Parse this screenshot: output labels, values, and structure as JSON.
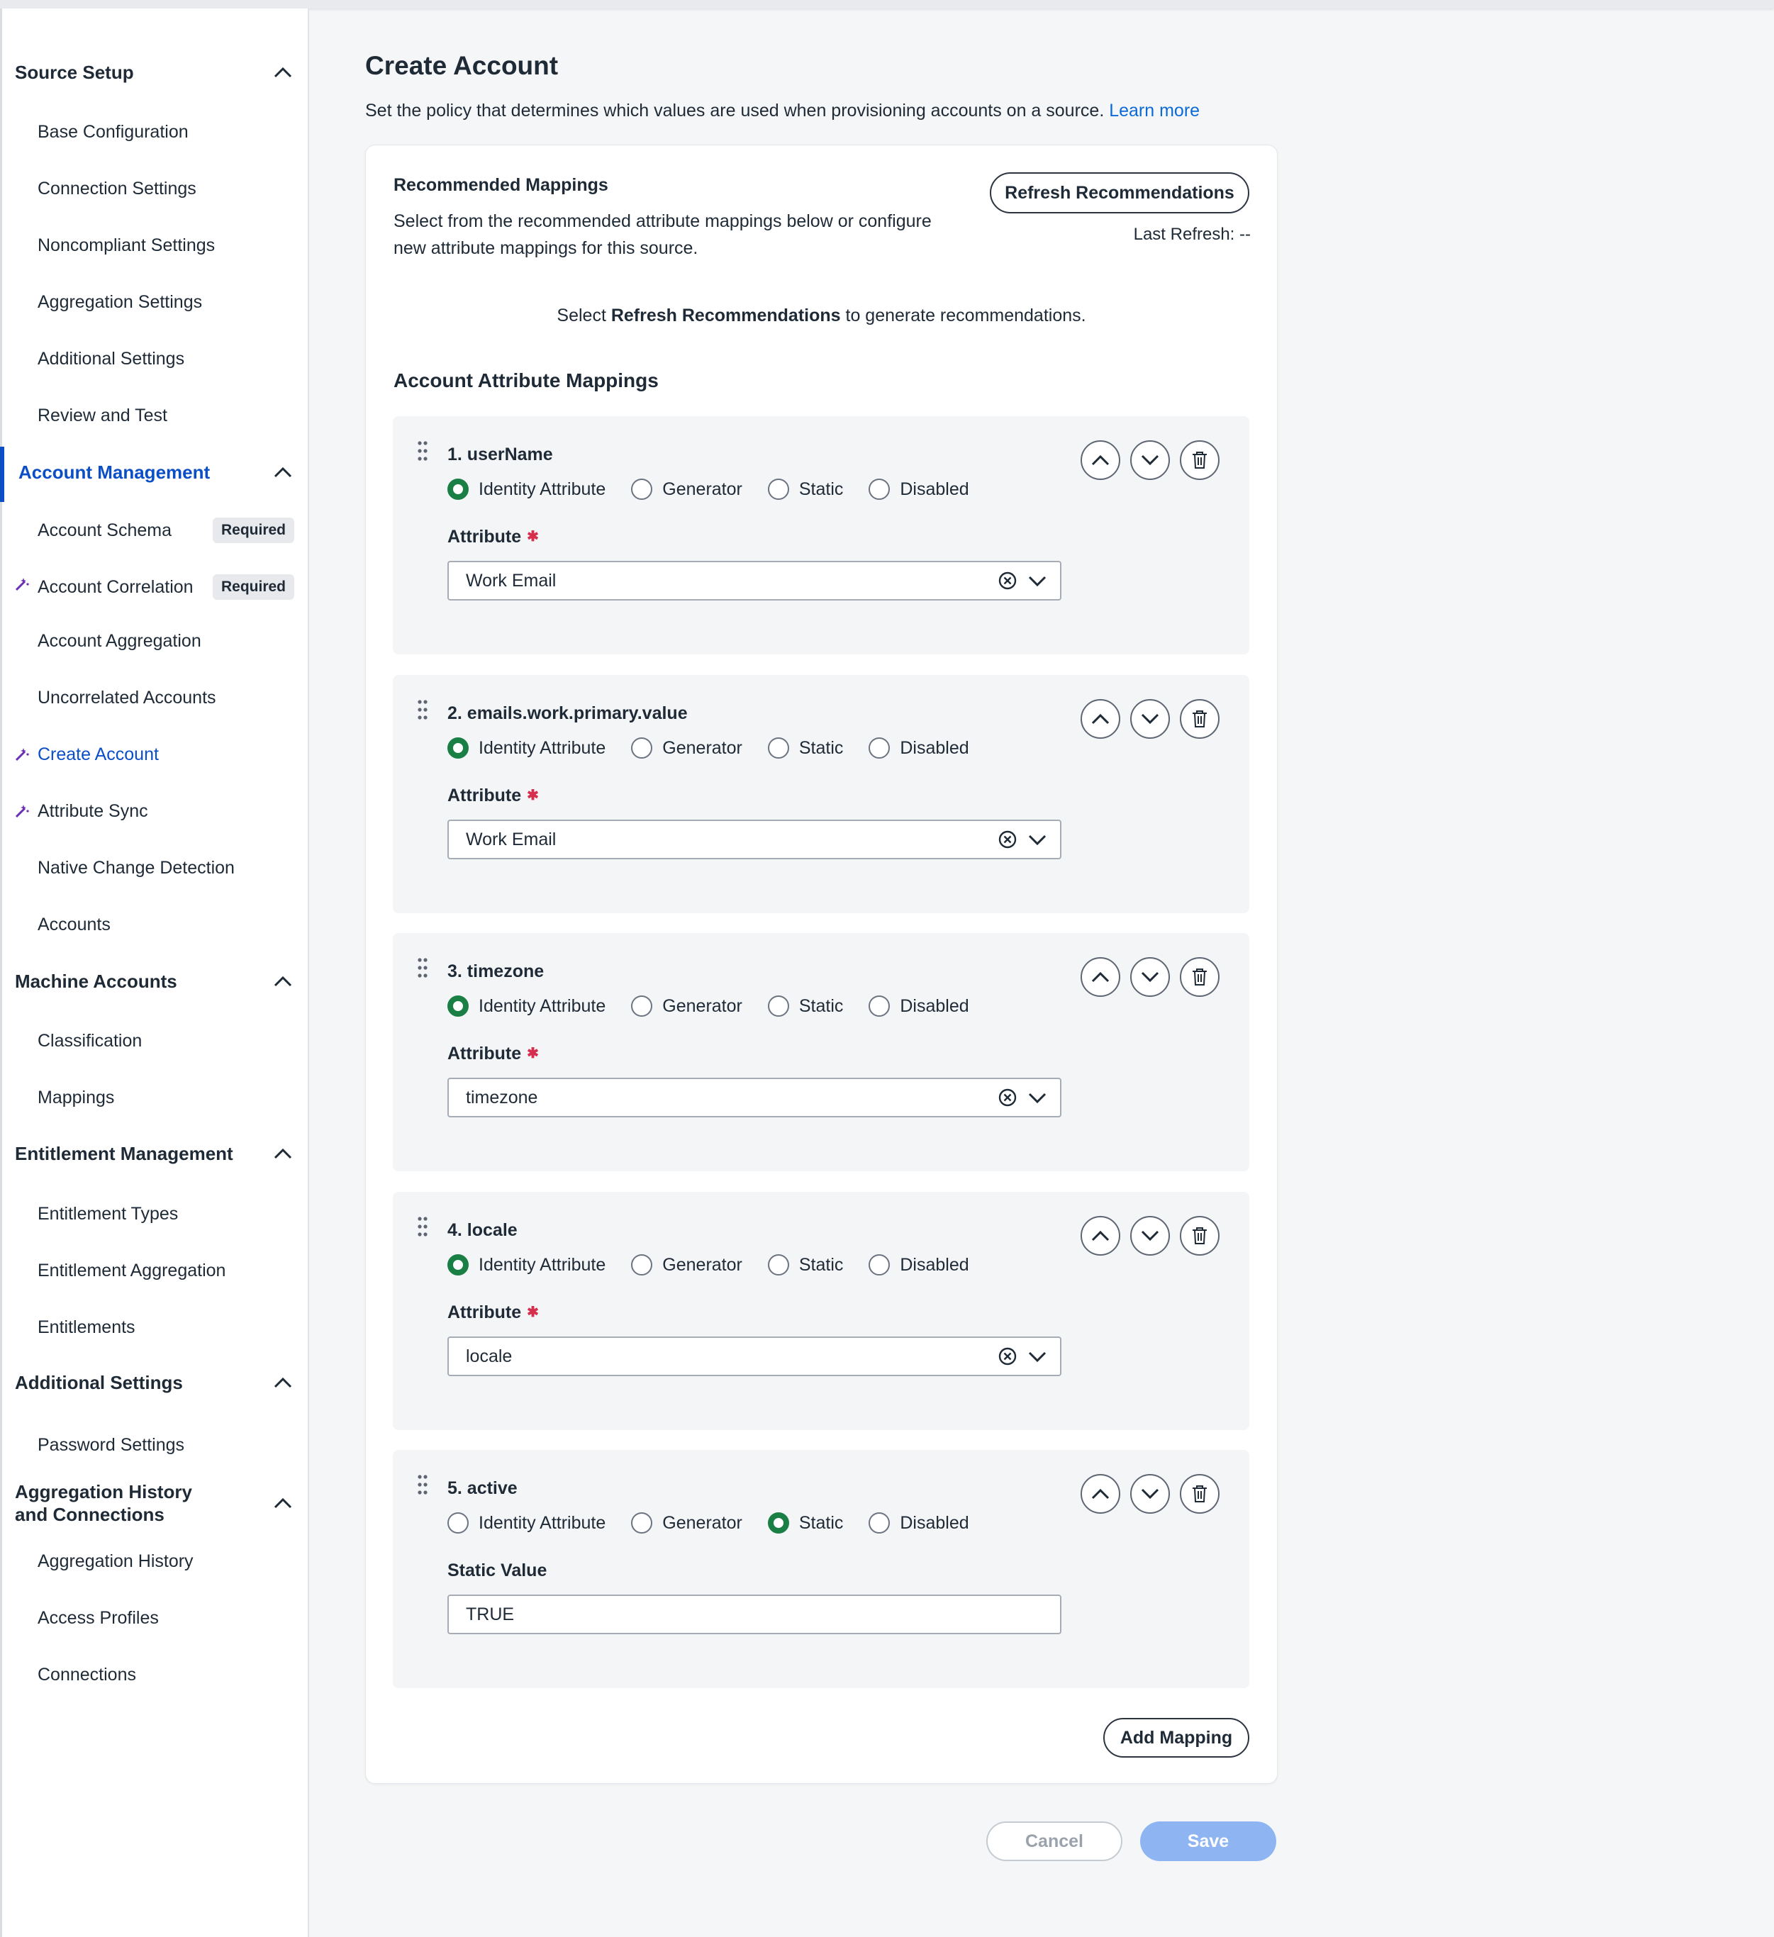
{
  "sidebar": {
    "sections": [
      {
        "label": "Source Setup",
        "items": [
          "Base Configuration",
          "Connection Settings",
          "Noncompliant Settings",
          "Aggregation Settings",
          "Additional Settings",
          "Review and Test"
        ]
      },
      {
        "label": "Account Management",
        "items": [
          "Account Schema",
          "Account Correlation",
          "Account Aggregation",
          "Uncorrelated Accounts",
          "Create Account",
          "Attribute Sync",
          "Native Change Detection",
          "Accounts"
        ]
      },
      {
        "label": "Machine Accounts",
        "items": [
          "Classification",
          "Mappings"
        ]
      },
      {
        "label": "Entitlement Management",
        "items": [
          "Entitlement Types",
          "Entitlement Aggregation",
          "Entitlements"
        ]
      },
      {
        "label": "Additional Settings",
        "items": [
          "Password Settings"
        ]
      },
      {
        "label": "Aggregation History and Connections",
        "items": [
          "Aggregation History",
          "Access Profiles",
          "Connections"
        ]
      }
    ],
    "badge_required": "Required"
  },
  "page": {
    "title": "Create Account",
    "description": "Set the policy that determines which values are used when provisioning accounts on a source.",
    "learn_more": "Learn more"
  },
  "recommended": {
    "title": "Recommended Mappings",
    "description": "Select from the recommended attribute mappings below or configure new attribute mappings for this source.",
    "refresh_button": "Refresh Recommendations",
    "last_refresh": "Last Refresh: --",
    "hint_prefix": "Select",
    "hint_bold": "Refresh Recommendations",
    "hint_suffix": "to generate recommendations."
  },
  "mappings_title": "Account Attribute Mappings",
  "radio_labels": [
    "Identity Attribute",
    "Generator",
    "Static",
    "Disabled"
  ],
  "mappings": [
    {
      "title": "1. userName",
      "field_label": "Attribute",
      "value": "Work Email"
    },
    {
      "title": "2. emails.work.primary.value",
      "field_label": "Attribute",
      "value": "Work Email"
    },
    {
      "title": "3. timezone",
      "field_label": "Attribute",
      "value": "timezone"
    },
    {
      "title": "4. locale",
      "field_label": "Attribute",
      "value": "locale"
    },
    {
      "title": "5. active",
      "field_label": "Static Value",
      "value": "TRUE"
    }
  ],
  "add_mapping": "Add Mapping",
  "footer": {
    "cancel": "Cancel",
    "save": "Save"
  },
  "colors": {
    "accent": "#0b4fc7",
    "radio_checked": "#1a7f45",
    "required": "#d62e4d",
    "save_disabled": "#8fb4f2"
  }
}
